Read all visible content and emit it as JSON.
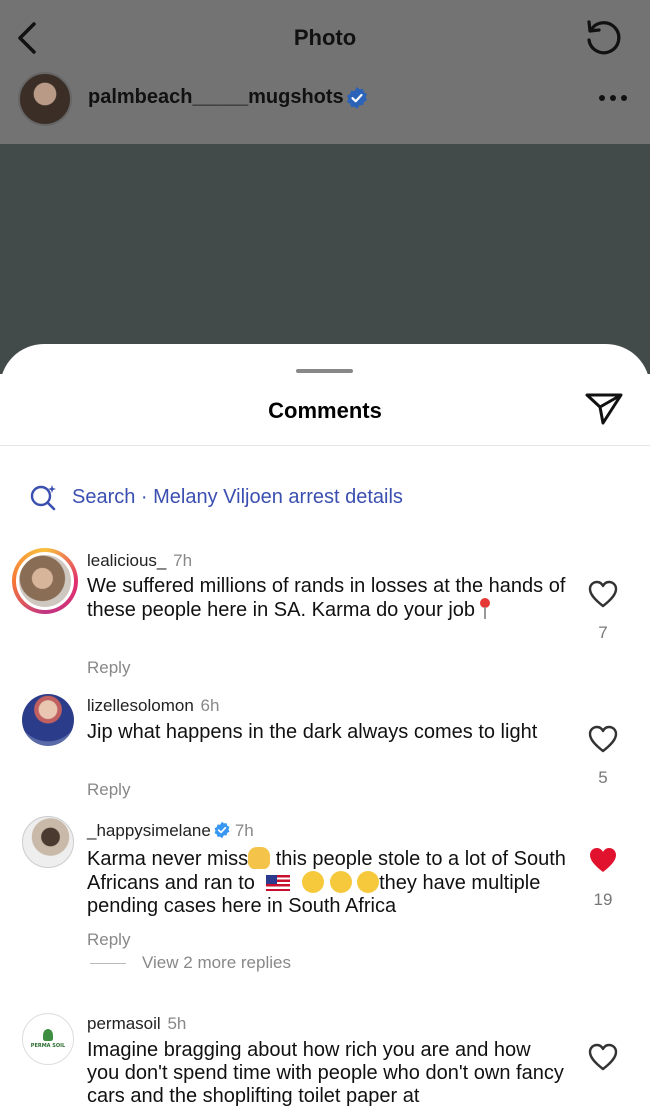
{
  "topbar": {
    "title": "Photo"
  },
  "post": {
    "username": "palmbeach_____mugshots",
    "verified": true
  },
  "sheet": {
    "title": "Comments"
  },
  "search": {
    "label": "Search · Melany Viljoen arrest details"
  },
  "comments": [
    {
      "username": "lealicious_",
      "time": "7h",
      "text": "We suffered millions of rands in losses at the hands of these people here in SA. Karma do your job",
      "likes": "7",
      "liked": false,
      "reply": "Reply"
    },
    {
      "username": "lizellesolomon",
      "time": "6h",
      "text": "Jip what happens in the dark always comes to light",
      "likes": "5",
      "liked": false,
      "reply": "Reply"
    },
    {
      "username": "_happysimelane",
      "time": "7h",
      "verified": true,
      "text_part1": "Karma never miss",
      "text_part2": " this people stole to a lot of South Africans and ran to ",
      "text_part3": "they have multiple pending cases here in South Africa",
      "likes": "19",
      "liked": true,
      "reply": "Reply",
      "view_replies": "View 2 more replies"
    },
    {
      "username": "permasoil",
      "time": "5h",
      "text": "Imagine bragging about how rich you are and how you don't spend time with people who don't own fancy cars and the shoplifting toilet paper at",
      "avatar_text": "PERMA SOIL",
      "liked": false
    }
  ],
  "colors": {
    "accent": "#3b4fb0",
    "liked_heart": "#e0122d",
    "verified": "#3897f0"
  }
}
